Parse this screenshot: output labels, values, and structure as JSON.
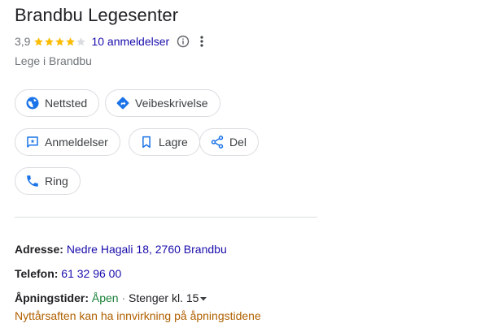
{
  "place": {
    "title": "Brandbu Legesenter",
    "rating_value": "3,9",
    "rating": 3.9,
    "stars_out_of": 5,
    "reviews_link": "10 anmeldelser",
    "category": "Lege i Brandbu"
  },
  "buttons": {
    "website": "Nettsted",
    "directions": "Veibeskrivelse",
    "reviews": "Anmeldelser",
    "save": "Lagre",
    "share": "Del",
    "call": "Ring"
  },
  "details": {
    "address_label": "Adresse:",
    "address_value": "Nedre Hagali 18, 2760 Brandbu",
    "phone_label": "Telefon:",
    "phone_value": "61 32 96 00",
    "hours_label": "Åpningstider:",
    "hours_status": "Åpen",
    "hours_separator": " · ",
    "hours_closes": "Stenger kl. 15",
    "hours_notice": "Nyttårsaften kan ha innvirkning på åpningstidene"
  },
  "colors": {
    "star_filled": "#fbbc04",
    "star_empty": "#dadce0",
    "icon_blue": "#1a73e8",
    "link": "#1a0dab",
    "open_green": "#188038",
    "notice_orange": "#b06000"
  },
  "icons": {
    "website": "globe-icon",
    "directions": "directions-icon",
    "reviews": "review-icon",
    "save": "bookmark-icon",
    "share": "share-icon",
    "call": "phone-icon"
  }
}
